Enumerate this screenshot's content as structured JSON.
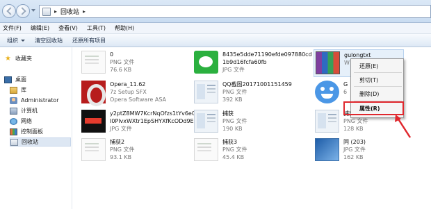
{
  "window": {
    "breadcrumb": "回收站"
  },
  "menu": [
    "文件(F)",
    "编辑(E)",
    "查看(V)",
    "工具(T)",
    "帮助(H)"
  ],
  "toolbar": {
    "organize": "组织",
    "empty_bin": "清空回收站",
    "restore_all": "还原所有项目"
  },
  "sidebar": {
    "favorites": "收藏夹",
    "desktop": "桌面",
    "library": "库",
    "administrator": "Administrator",
    "computer": "计算机",
    "network": "网络",
    "control_panel": "控制面板",
    "recycle_bin": "回收站"
  },
  "files": [
    {
      "name": "0",
      "type": "PNG 文件",
      "size": "76.6 KB",
      "icon": "document-thumb"
    },
    {
      "name": "8435e5dde71190efde097880cd",
      "name2": "1b9d16fcfa60fb",
      "type": "JPG 文件",
      "size": "",
      "icon": "wechat-thumb"
    },
    {
      "name": "gulongtxt",
      "type": "W",
      "size": "",
      "icon": "winrar-icon"
    },
    {
      "name": "Opera_11.62",
      "type": "7z Setup SFX",
      "size": "Opera Software ASA",
      "icon": "opera-icon"
    },
    {
      "name": "QQ截图20171001151459",
      "type": "PNG 文件",
      "size": "392 KB",
      "icon": "screenshot-thumb"
    },
    {
      "name": "G",
      "type": "6",
      "size": "",
      "icon": "smiley-thumb"
    },
    {
      "name": "y2ptZ8MW7KcrNqOfzs1tYv6e02",
      "name2": "I0PlvxWXtr1EpSHYXfKcODd9E...",
      "type": "JPG 文件",
      "size": "",
      "icon": "black-thumb"
    },
    {
      "name": "捕获",
      "type": "PNG 文件",
      "size": "190 KB",
      "icon": "screenshot-thumb"
    },
    {
      "name": "捕获",
      "type": "PNG 文件",
      "size": "128 KB",
      "icon": "screenshot-thumb"
    },
    {
      "name": "捕获2",
      "type": "PNG 文件",
      "size": "93.1 KB",
      "icon": "document-thumb"
    },
    {
      "name": "捕获3",
      "type": "PNG 文件",
      "size": "45.4 KB",
      "icon": "document-thumb"
    },
    {
      "name": "同 (203)",
      "type": "JPG 文件",
      "size": "162 KB",
      "icon": "blue-photo-thumb"
    }
  ],
  "context_menu": {
    "restore": "还原(E)",
    "cut": "剪切(T)",
    "delete": "删除(D)",
    "properties": "属性(R)"
  },
  "colors": {
    "highlight": "#e0272d"
  }
}
